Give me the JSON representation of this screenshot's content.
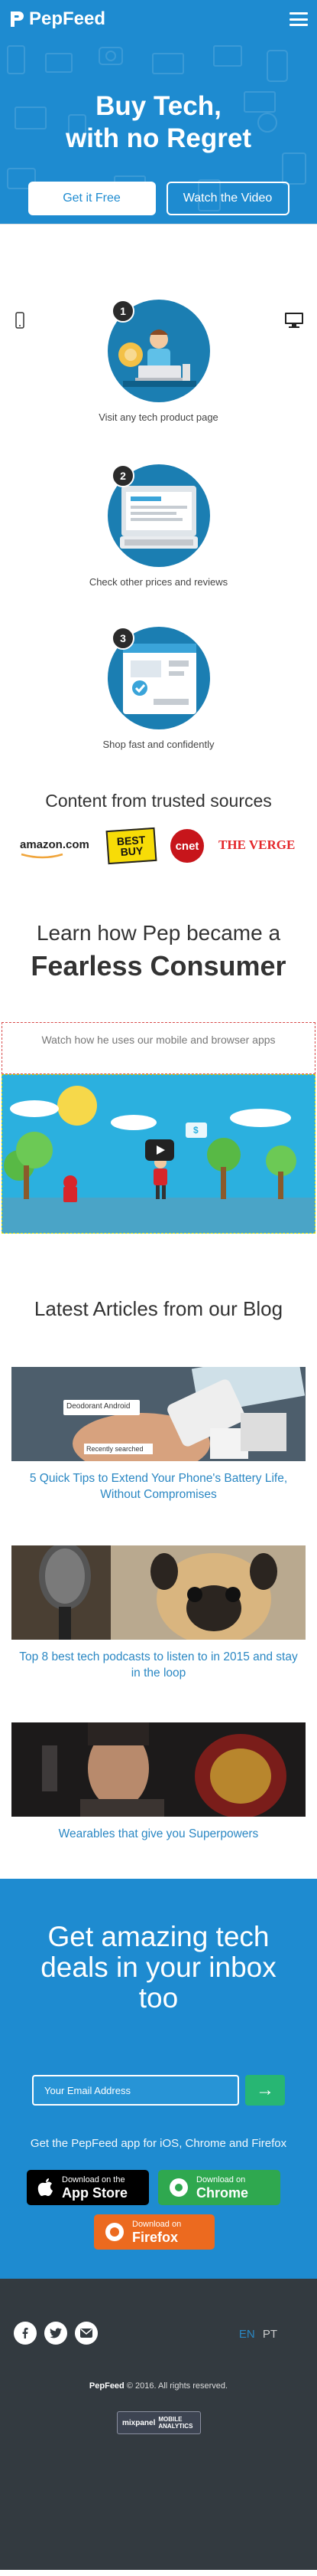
{
  "header": {
    "brand": "PepFeed",
    "hero_title_line1": "Buy Tech,",
    "hero_title_line2": "with no Regret",
    "cta_primary": "Get it Free",
    "cta_secondary": "Watch the Video"
  },
  "steps": [
    {
      "number": "1",
      "text": "Visit any tech product page"
    },
    {
      "number": "2",
      "text": "Check other prices and reviews"
    },
    {
      "number": "3",
      "text": "Shop fast and confidently"
    }
  ],
  "trusted": {
    "title": "Content from trusted sources",
    "logos": [
      "amazon.com",
      "BEST BUY",
      "cnet",
      "THE VERGE"
    ]
  },
  "learn": {
    "subtitle": "Learn how Pep became a",
    "title": "Fearless Consumer",
    "watch_text": "Watch how he uses our mobile and browser apps",
    "video_bubble": "$"
  },
  "articles": {
    "section_title": "Latest Articles from our Blog",
    "items": [
      {
        "title": "5 Quick Tips to Extend Your Phone's Battery Life, Without Compromises",
        "image_badge_1": "Deodorant Android",
        "image_badge_2": "Recently searched"
      },
      {
        "title": "Top 8 best tech podcasts to listen to in 2015 and stay in the loop"
      },
      {
        "title": "Wearables that give you Superpowers"
      }
    ]
  },
  "newsletter": {
    "title_line1": "Get amazing tech",
    "title_line2": "deals in your inbox",
    "title_line3": "too",
    "email_placeholder": "Your Email Address",
    "submit_arrow": "→",
    "apps_text": "Get the PepFeed app for iOS, Chrome and Firefox",
    "stores": [
      {
        "small": "Download on the",
        "big": "App Store"
      },
      {
        "small": "Download on",
        "big": "Chrome"
      },
      {
        "small": "Download on",
        "big": "Firefox"
      }
    ]
  },
  "footer": {
    "lang_en": "EN",
    "lang_pt": "PT",
    "copyright_brand": "PepFeed",
    "copyright_text": "© 2016. All rights reserved.",
    "mixpanel_name": "mixpanel",
    "mixpanel_tag_1": "MOBILE",
    "mixpanel_tag_2": "ANALYTICS"
  },
  "colors": {
    "brand_blue": "#1e8bd0",
    "cta_green": "#27b673",
    "chrome_green": "#2fa84f",
    "firefox_orange": "#ec6a1f",
    "footer_dark": "#333a40"
  }
}
